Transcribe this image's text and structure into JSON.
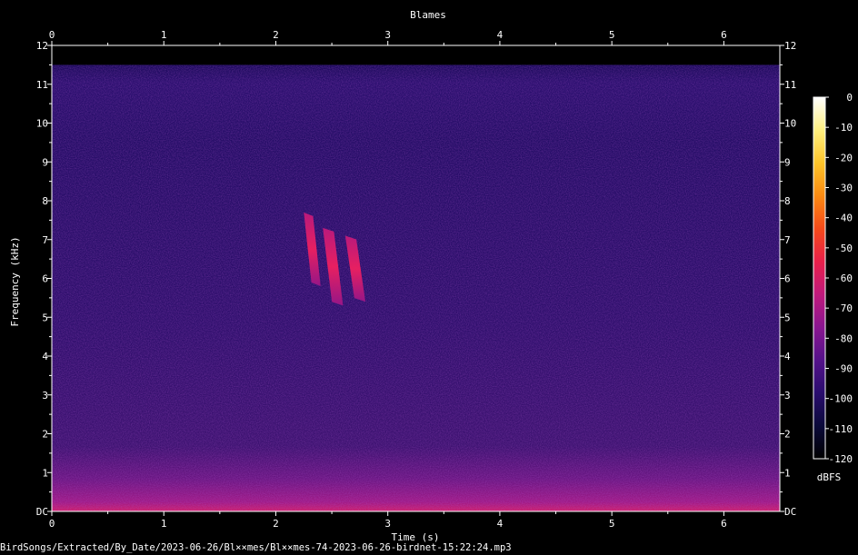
{
  "chart_data": {
    "type": "heatmap",
    "title": "Blames",
    "xlabel": "Time (s)",
    "ylabel": "Frequency (kHz)",
    "xlim": [
      0,
      6.5
    ],
    "ylim": [
      0,
      12
    ],
    "x_ticks": [
      "0",
      "1",
      "2",
      "3",
      "4",
      "5",
      "6"
    ],
    "y_ticks": [
      "DC",
      "1",
      "2",
      "3",
      "4",
      "5",
      "6",
      "7",
      "8",
      "9",
      "10",
      "11",
      "12"
    ],
    "colorbar": {
      "label": "dBFS",
      "range": [
        -120,
        0
      ],
      "ticks": [
        "0",
        "-10",
        "-20",
        "-30",
        "-40",
        "-50",
        "-60",
        "-70",
        "-80",
        "-90",
        "-100",
        "-110",
        "-120"
      ],
      "colors": [
        "#000000",
        "#0b0a3a",
        "#2a0d6e",
        "#55128a",
        "#8a1690",
        "#c01a7c",
        "#e8204a",
        "#f54a1a",
        "#fb8a12",
        "#fdc42a",
        "#fff080",
        "#ffffff"
      ]
    },
    "calls": [
      {
        "t_start": 2.25,
        "t_end": 2.4,
        "f_high": 7.7,
        "f_low": 5.8
      },
      {
        "t_start": 2.42,
        "t_end": 2.6,
        "f_high": 7.3,
        "f_low": 5.3
      },
      {
        "t_start": 2.62,
        "t_end": 2.8,
        "f_high": 7.1,
        "f_low": 5.4
      }
    ],
    "grid": false
  },
  "footer_path": "BirdSongs/Extracted/By_Date/2023-06-26/Bl××mes/Bl××mes-74-2023-06-26-birdnet-15:22:24.mp3"
}
